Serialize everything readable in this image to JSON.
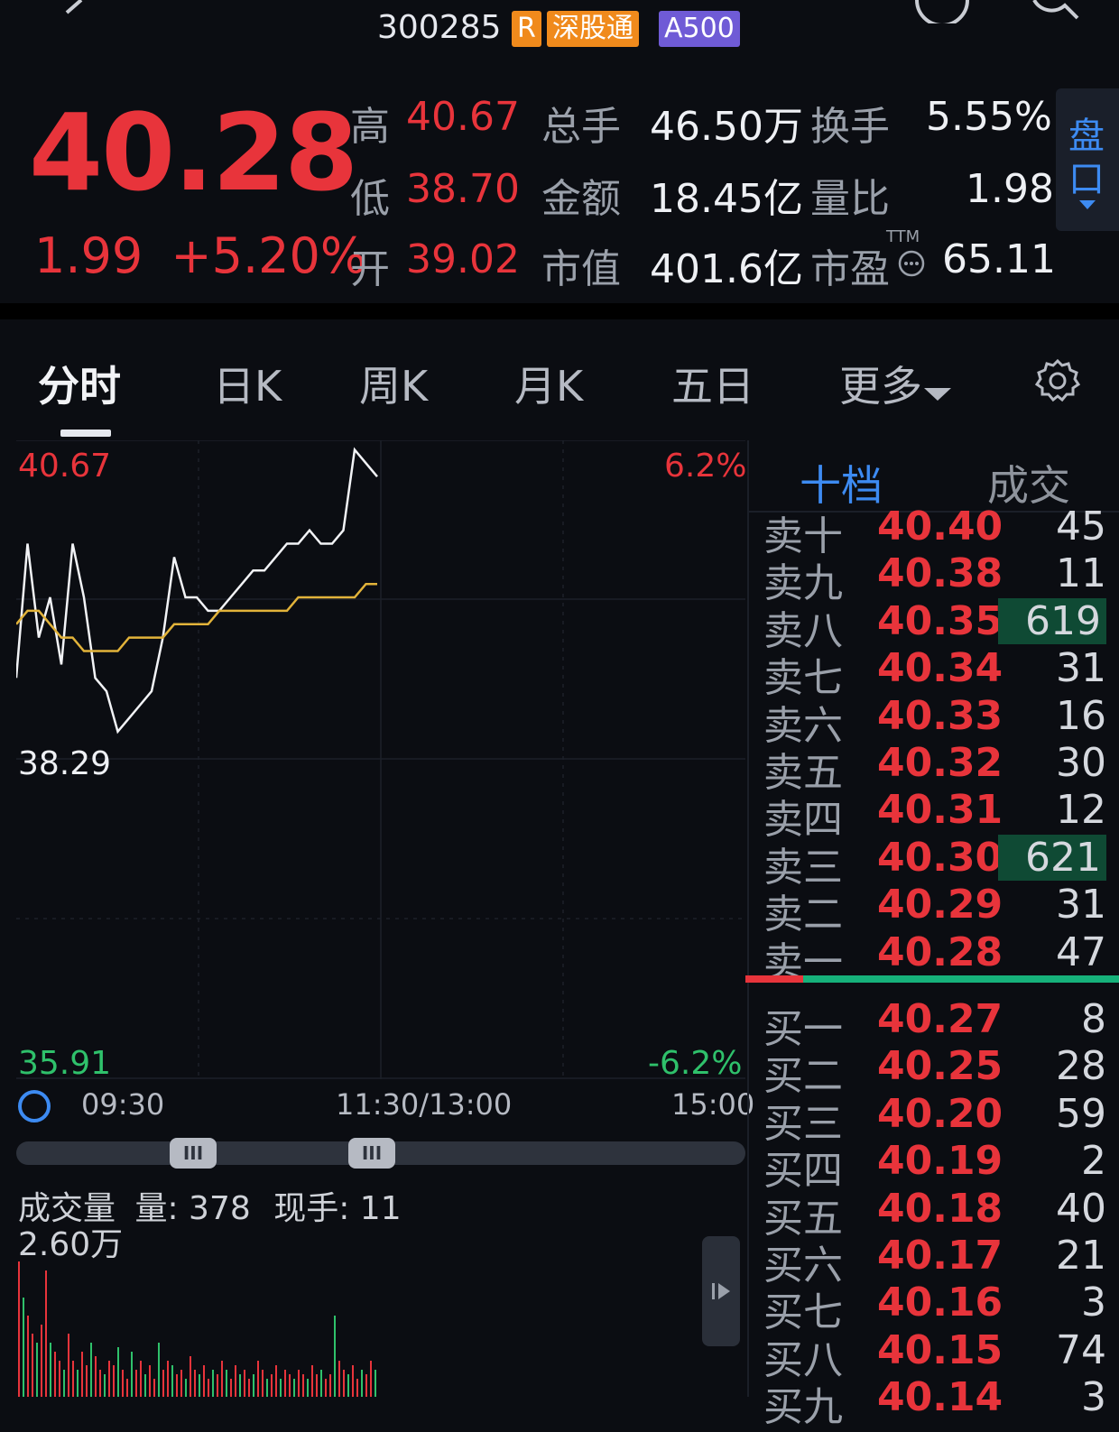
{
  "header": {
    "code": "300285",
    "tags": [
      "R",
      "深股通",
      "A500"
    ]
  },
  "quote": {
    "price": "40.28",
    "change": "1.99",
    "change_pct": "+5.20%",
    "high_label": "高",
    "high": "40.67",
    "low_label": "低",
    "low": "38.70",
    "open_label": "开",
    "open": "39.02",
    "volume_label": "总手",
    "volume": "46.50万",
    "amount_label": "金额",
    "amount": "18.45亿",
    "mktcap_label": "市值",
    "mktcap": "401.6亿",
    "turnover_label": "换手",
    "turnover": "5.55%",
    "vol_ratio_label": "量比",
    "vol_ratio": "1.98",
    "pe_label": "市盈",
    "pe_sup": "TTM",
    "pe": "65.11",
    "panko_label_1": "盘",
    "panko_label_2": "口"
  },
  "tabs": [
    "分时",
    "日K",
    "周K",
    "月K",
    "五日",
    "更多"
  ],
  "chart": {
    "y_top": "40.67",
    "y_mid": "38.29",
    "y_bottom": "35.91",
    "pct_top": "6.2%",
    "pct_bottom": "-6.2%",
    "time_start": "09:30",
    "time_mid": "11:30/13:00",
    "time_end": "15:00",
    "volume_title": "成交量",
    "volume_q_label": "量: 378",
    "volume_cur_label": "现手: 11",
    "volume_max": "2.60万"
  },
  "chart_data": {
    "type": "line",
    "ylim": [
      35.91,
      40.67
    ],
    "series": [
      {
        "values": [
          38.9,
          39.9,
          39.2,
          39.5,
          39.0,
          39.9,
          39.5,
          38.9,
          38.8,
          38.5,
          38.6,
          38.7,
          38.8,
          39.2,
          39.8,
          39.5,
          39.5,
          39.4,
          39.4,
          39.5,
          39.6,
          39.7,
          39.7,
          39.8,
          39.9,
          39.9,
          40.0,
          39.9,
          39.9,
          40.0,
          40.6,
          40.5,
          40.4
        ]
      },
      {
        "values": [
          39.3,
          39.4,
          39.4,
          39.3,
          39.2,
          39.2,
          39.1,
          39.1,
          39.1,
          39.1,
          39.2,
          39.2,
          39.2,
          39.2,
          39.3,
          39.3,
          39.3,
          39.3,
          39.4,
          39.4,
          39.4,
          39.4,
          39.4,
          39.4,
          39.4,
          39.5,
          39.5,
          39.5,
          39.5,
          39.5,
          39.5,
          39.6,
          39.6
        ]
      }
    ]
  },
  "orderbook": {
    "tab_active": "十档",
    "tab_other": "成交",
    "asks": [
      {
        "label": "卖十",
        "price": "40.40",
        "qty": "45",
        "hl": false
      },
      {
        "label": "卖九",
        "price": "40.38",
        "qty": "11",
        "hl": false
      },
      {
        "label": "卖八",
        "price": "40.35",
        "qty": "619",
        "hl": true
      },
      {
        "label": "卖七",
        "price": "40.34",
        "qty": "31",
        "hl": false
      },
      {
        "label": "卖六",
        "price": "40.33",
        "qty": "16",
        "hl": false
      },
      {
        "label": "卖五",
        "price": "40.32",
        "qty": "30",
        "hl": false
      },
      {
        "label": "卖四",
        "price": "40.31",
        "qty": "12",
        "hl": false
      },
      {
        "label": "卖三",
        "price": "40.30",
        "qty": "621",
        "hl": true
      },
      {
        "label": "卖二",
        "price": "40.29",
        "qty": "31",
        "hl": false
      },
      {
        "label": "卖一",
        "price": "40.28",
        "qty": "47",
        "hl": false
      }
    ],
    "bids": [
      {
        "label": "买一",
        "price": "40.27",
        "qty": "8"
      },
      {
        "label": "买二",
        "price": "40.25",
        "qty": "28"
      },
      {
        "label": "买三",
        "price": "40.20",
        "qty": "59"
      },
      {
        "label": "买四",
        "price": "40.19",
        "qty": "2"
      },
      {
        "label": "买五",
        "price": "40.18",
        "qty": "40"
      },
      {
        "label": "买六",
        "price": "40.17",
        "qty": "21"
      },
      {
        "label": "买七",
        "price": "40.16",
        "qty": "3"
      },
      {
        "label": "买八",
        "price": "40.15",
        "qty": "74"
      },
      {
        "label": "买九",
        "price": "40.14",
        "qty": "3"
      }
    ]
  },
  "colors": {
    "up": "#e8343b",
    "down": "#2fc16b",
    "avg_line": "#e2b33a",
    "accent": "#3d8bf2"
  }
}
